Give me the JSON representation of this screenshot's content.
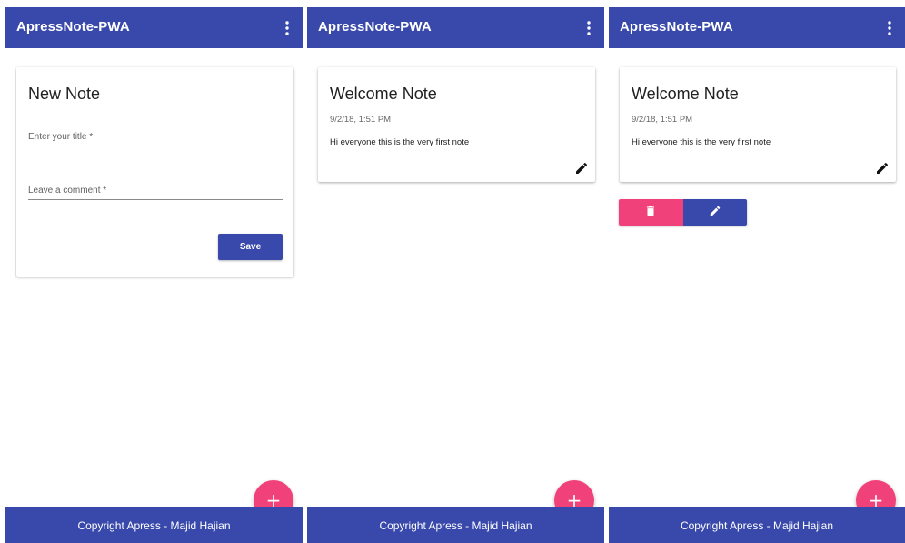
{
  "colors": {
    "primary": "#3949ab",
    "accent": "#f1417a"
  },
  "icons": {
    "menu": "more-vert-icon",
    "edit": "pencil-icon",
    "delete": "trash-icon",
    "add": "plus-icon"
  },
  "screens": [
    {
      "app_title": "ApressNote-PWA",
      "card": {
        "title": "New Note",
        "title_field": {
          "placeholder": "Enter your title *",
          "value": ""
        },
        "comment_field": {
          "placeholder": "Leave a comment *",
          "value": ""
        },
        "save_label": "Save"
      },
      "fab_label": "+",
      "footer": "Copyright Apress - Majid Hajian"
    },
    {
      "app_title": "ApressNote-PWA",
      "note": {
        "title": "Welcome Note",
        "date": "9/2/18, 1:51 PM",
        "body": "Hi everyone this is the very first note"
      },
      "fab_label": "+",
      "footer": "Copyright Apress - Majid Hajian"
    },
    {
      "app_title": "ApressNote-PWA",
      "note": {
        "title": "Welcome Note",
        "date": "9/2/18, 1:51 PM",
        "body": "Hi everyone this is the very first note"
      },
      "fab_label": "+",
      "footer": "Copyright Apress - Majid Hajian"
    }
  ]
}
